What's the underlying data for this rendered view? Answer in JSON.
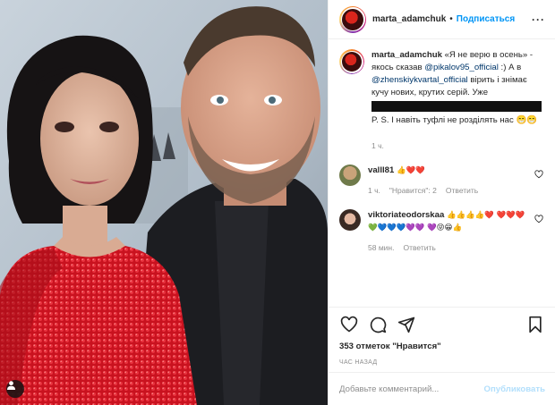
{
  "post": {
    "username": "marta_adamchuk",
    "follow_label": "Подписаться",
    "separator": "•",
    "more_label": "···"
  },
  "caption": {
    "username": "marta_adamchuk",
    "text_a": "«Я не верю в осень» - якось сказав ",
    "mention1": "@pikalov95_official",
    "text_b": " :) А в ",
    "mention2": "@zhenskiykvartal_official",
    "text_c": " вірить і знімає кучу нових, крутих серій. Уже",
    "text_d": "P. S. І навіть туфлі не розділять нас 😁😁",
    "time": "1 ч."
  },
  "comments": [
    {
      "username": "valll81",
      "text": "👍❤️❤️",
      "time": "1 ч.",
      "likes": "\"Нравится\": 2",
      "reply": "Ответить"
    },
    {
      "username": "viktoriateodorskaa",
      "text": "👍👍👍👍❤️ ❤️❤️❤️💚💙💙💙💜💜 💜😝😁👍",
      "time": "58 мин.",
      "reply": "Ответить"
    }
  ],
  "footer": {
    "likes_text": "353 отметок \"Нравится\"",
    "time_ago": "час назад",
    "comment_placeholder": "Добавьте комментарий...",
    "publish_label": "Опубликовать"
  },
  "icons": {
    "like": "heart-icon",
    "comment": "comment-icon",
    "share": "share-icon",
    "save": "bookmark-icon",
    "tag": "user-tag-icon",
    "more": "more-options-icon"
  },
  "colors": {
    "link_blue": "#0095f6",
    "mention": "#00376b",
    "muted": "#8e8e8e",
    "publish_disabled": "#b2dffc",
    "dress_red": "#d21a26"
  }
}
